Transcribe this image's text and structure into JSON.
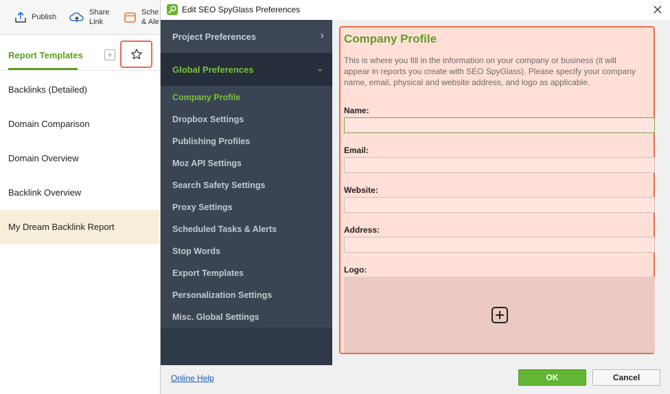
{
  "toolbar": {
    "publish_label": "Publish",
    "share_label_1": "Share",
    "share_label_2": "Link",
    "schedule_label_1": "Sche",
    "schedule_label_2": "& Ale"
  },
  "report_panel": {
    "tab_label": "Report Templates",
    "add_symbol": "+",
    "templates": [
      {
        "label": "Backlinks (Detailed)",
        "selected": false
      },
      {
        "label": "Domain Comparison",
        "selected": false
      },
      {
        "label": "Domain Overview",
        "selected": false
      },
      {
        "label": "Backlink Overview",
        "selected": false
      },
      {
        "label": "My Dream Backlink Report",
        "selected": true
      }
    ]
  },
  "dialog": {
    "title": "Edit SEO SpyGlass Preferences",
    "nav": {
      "project_label": "Project Preferences",
      "project_chevron": "›",
      "global_label": "Global Preferences",
      "global_chevron": "⌄",
      "items": [
        "Company Profile",
        "Dropbox Settings",
        "Publishing Profiles",
        "Moz API Settings",
        "Search Safety Settings",
        "Proxy Settings",
        "Scheduled Tasks & Alerts",
        "Stop Words",
        "Export Templates",
        "Personalization Settings",
        "Misc. Global Settings"
      ],
      "active_item": "Company Profile"
    },
    "content": {
      "title": "Company Profile",
      "description": "This is where you fill in the information on your company or business (it will appear in reports you create with SEO SpyGlass). Please specify your company name, email, physical and website address, and logo as applicable.",
      "name_label": "Name:",
      "name_value": "",
      "email_label": "Email:",
      "email_value": "",
      "website_label": "Website:",
      "website_value": "",
      "address_label": "Address:",
      "address_value": "",
      "logo_label": "Logo:"
    },
    "footer": {
      "help_link": "Online Help",
      "ok_label": "OK",
      "cancel_label": "Cancel"
    }
  },
  "colors": {
    "accent_green": "#5f9e27",
    "highlight_border": "#e96a4e",
    "nav_bg": "#2f3947"
  }
}
